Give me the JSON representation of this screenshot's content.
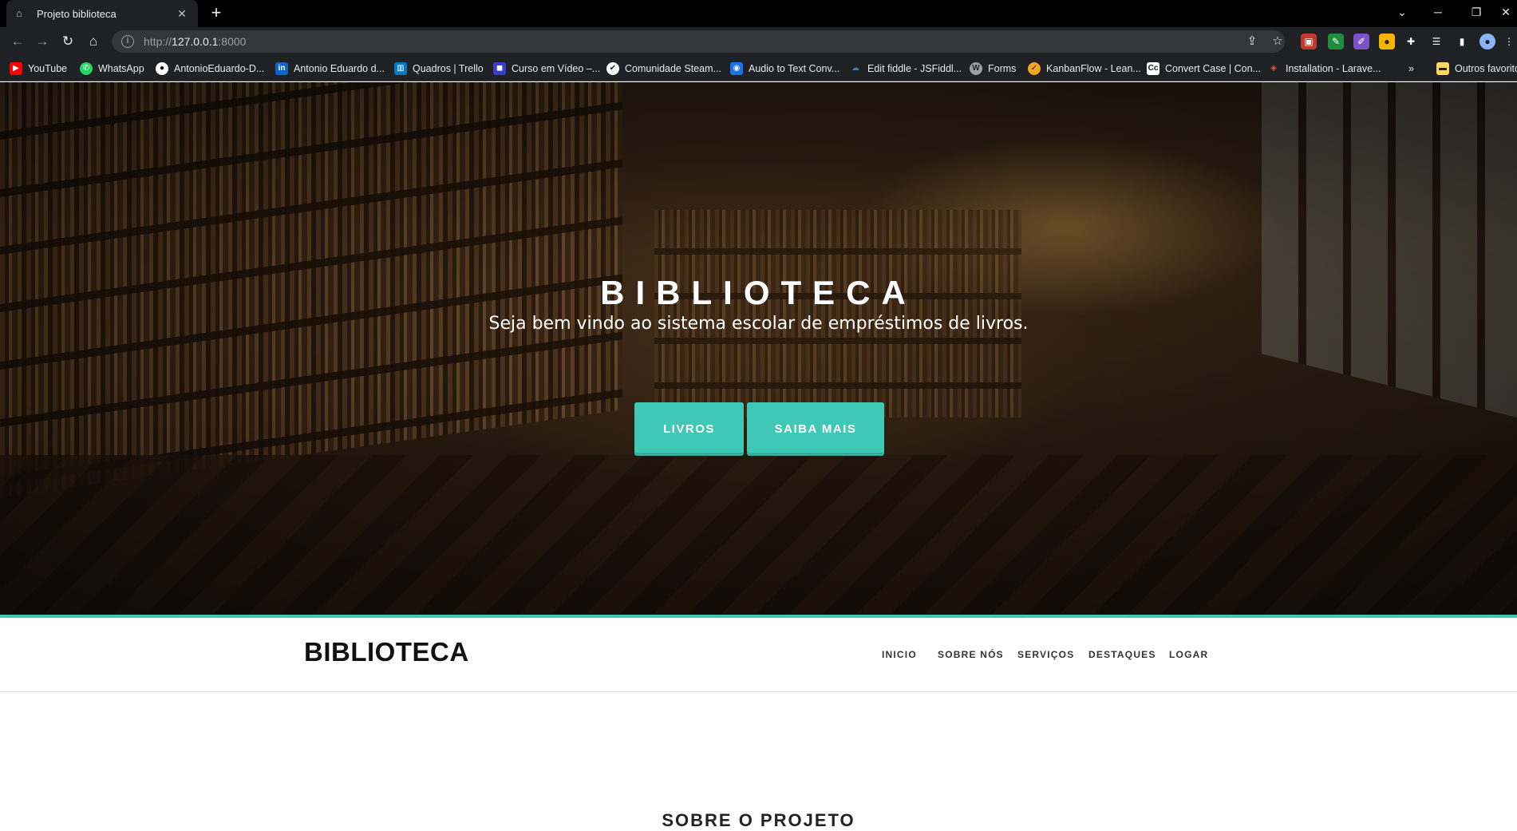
{
  "browser": {
    "tab_title": "Projeto biblioteca",
    "url_scheme": "http://",
    "url_host": "127.0.0.1",
    "url_port": ":8000",
    "bookmarks": [
      "YouTube",
      "WhatsApp",
      "AntonioEduardo-D...",
      "Antonio Eduardo d...",
      "Quadros | Trello",
      "Curso em Vídeo –...",
      "Comunidade Steam...",
      "Audio to Text Conv...",
      "Edit fiddle - JSFiddl...",
      "Forms",
      "KanbanFlow - Lean...",
      "Convert Case | Con...",
      "Installation - Larave..."
    ],
    "bookmarks_overflow": "»",
    "other_bookmarks": "Outros favoritos"
  },
  "hero": {
    "title": "BIBLIOTECA",
    "subtitle": "Seja bem vindo ao sistema escolar de empréstimos de livros.",
    "buttons": [
      "LIVROS",
      "SAIBA MAIS"
    ]
  },
  "colors": {
    "accent": "#3ec8b5",
    "chrome_dark": "#202124"
  },
  "nav": {
    "brand": "BIBLIOTECA",
    "links": [
      "INICIO",
      "SOBRE NÓS",
      "SERVIÇOS",
      "DESTAQUES",
      "LOGAR"
    ]
  },
  "section": {
    "title": "SOBRE O PROJETO"
  }
}
